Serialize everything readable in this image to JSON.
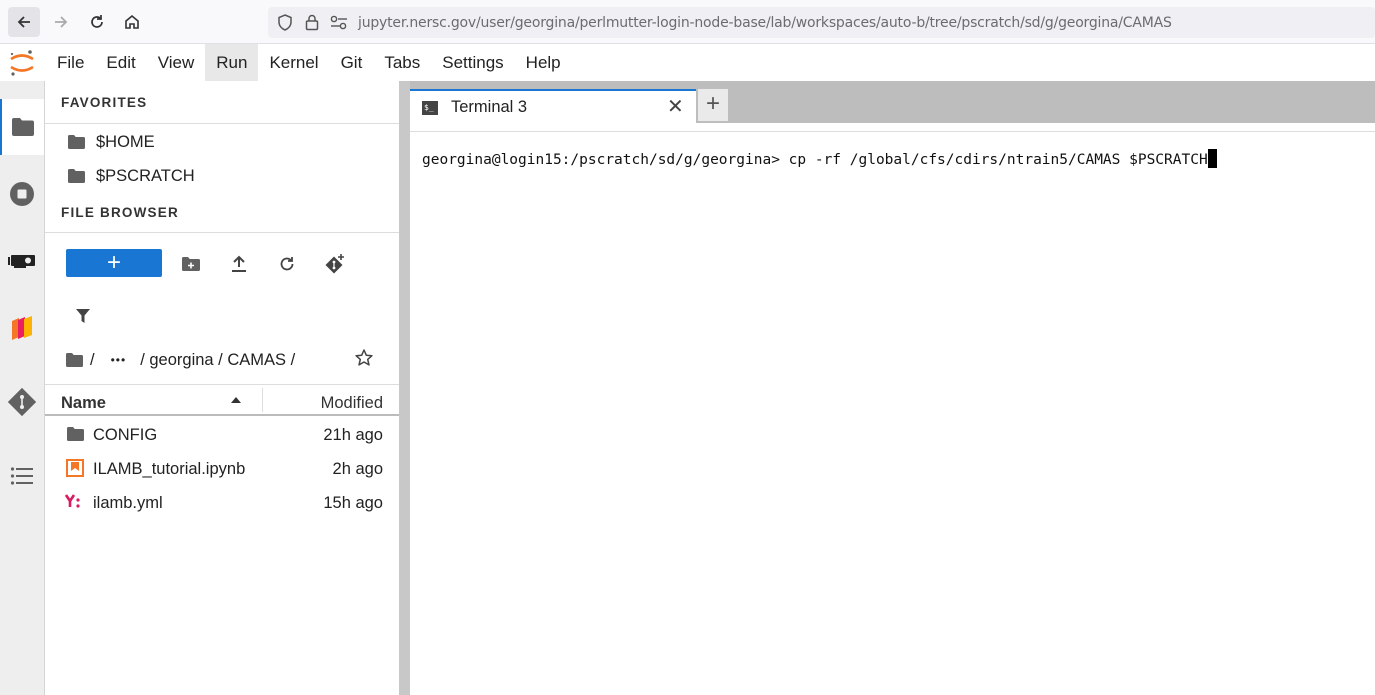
{
  "browser": {
    "url": "jupyter.nersc.gov/user/georgina/perlmutter-login-node-base/lab/workspaces/auto-b/tree/pscratch/sd/g/georgina/CAMAS"
  },
  "menubar": {
    "items": [
      "File",
      "Edit",
      "View",
      "Run",
      "Kernel",
      "Git",
      "Tabs",
      "Settings",
      "Help"
    ],
    "active": "Run"
  },
  "sidebar": {
    "favorites_title": "FAVORITES",
    "favorites": [
      "$HOME",
      "$PSCRATCH"
    ],
    "file_browser_title": "FILE BROWSER",
    "new_button_label": "+",
    "breadcrumb": {
      "root": "/",
      "ellipsis": "•••",
      "path": "/ georgina / CAMAS /"
    },
    "columns": {
      "name": "Name",
      "modified": "Modified"
    },
    "files": [
      {
        "name": "CONFIG",
        "modified": "21h ago",
        "icon": "folder-icon"
      },
      {
        "name": "ILAMB_tutorial.ipynb",
        "modified": "2h ago",
        "icon": "notebook-icon"
      },
      {
        "name": "ilamb.yml",
        "modified": "15h ago",
        "icon": "yaml-icon"
      }
    ]
  },
  "main": {
    "tab_label": "Terminal 3",
    "tab_icon_text": "$_",
    "close_glyph": "✕",
    "add_tab_glyph": "+",
    "terminal_line": "georgina@login15:/pscratch/sd/g/georgina> cp -rf /global/cfs/cdirs/ntrain5/CAMAS $PSCRATCH"
  },
  "colors": {
    "accent": "#1976d2",
    "jupyter_orange": "#f37726",
    "yaml_pink": "#d81b60"
  }
}
